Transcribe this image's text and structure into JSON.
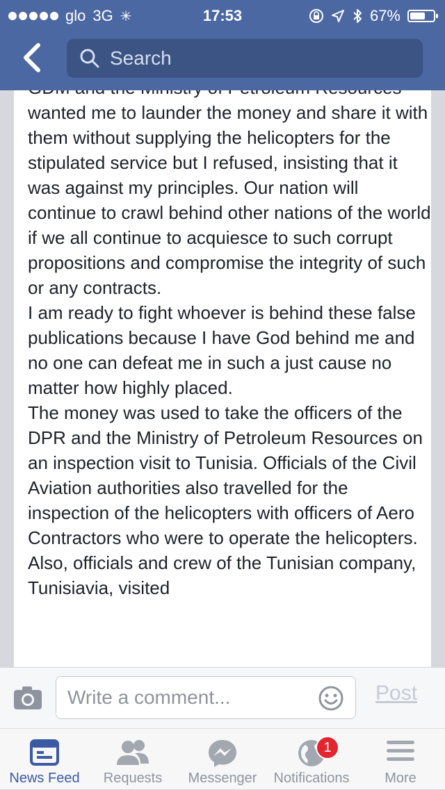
{
  "status_bar": {
    "carrier": "glo",
    "network": "3G",
    "time": "17:53",
    "battery": "67%",
    "battery_level": 0.67
  },
  "header": {
    "search_placeholder": "Search"
  },
  "article": {
    "paragraphs": [
      "GDM and the Ministry of Petroleum Resources wanted me to launder the money and share it with them without supplying the helicopters for the stipulated service but I refused, insisting that it was against my principles. Our nation will continue to crawl behind other nations of the world if we all continue to acquiesce to such corrupt propositions and compromise the integrity of such or any contracts.",
      "I am ready to fight whoever is behind these false publications because I have God behind me and no one can defeat me in such a just cause no matter how highly placed.",
      "The money was used to take the officers of the DPR and the Ministry of Petroleum Resources on an inspection visit to Tunisia. Officials of the Civil Aviation authorities also travelled for the inspection of the helicopters with officers of Aero Contractors who were to operate the helicopters. Also, officials and crew of the Tunisian company, Tunisiavia, visited"
    ]
  },
  "comment": {
    "placeholder": "Write a comment...",
    "post_label": "Post"
  },
  "tabs": {
    "news_feed": "News Feed",
    "requests": "Requests",
    "messenger": "Messenger",
    "notifications": "Notifications",
    "more": "More",
    "notifications_badge": "1"
  },
  "colors": {
    "header_bg": "#4c68a3",
    "accent": "#3b5aa3",
    "badge": "#e3252f"
  }
}
